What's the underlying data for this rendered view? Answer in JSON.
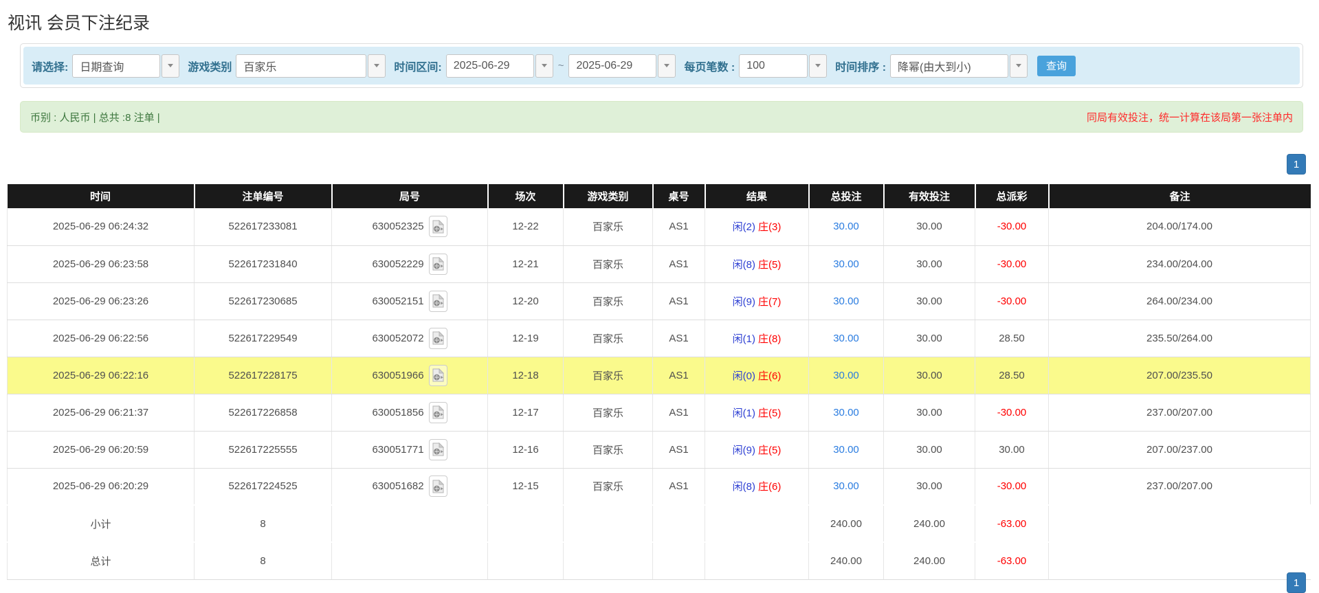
{
  "page_title": "视讯 会员下注纪录",
  "filter_bar": {
    "query_type": {
      "label": "请选择:",
      "value": "日期查询"
    },
    "game_category": {
      "label": "游戏类别",
      "value": "百家乐"
    },
    "time_range": {
      "label": "时间区间:",
      "from": "2025-06-29",
      "separator": "~",
      "to": "2025-06-29"
    },
    "page_size": {
      "label": "每页笔数 :",
      "value": "100"
    },
    "time_sort": {
      "label": "时间排序 :",
      "value": "降幂(由大到小)"
    },
    "search_button_label": "查询"
  },
  "summary_bar": {
    "currency_info": "币别 : 人民币 | 总共 :8 注单 |",
    "notice": "同局有效投注，统一计算在该局第一张注单内"
  },
  "pagination": {
    "current_page": "1"
  },
  "table": {
    "headers": [
      "时间",
      "注单编号",
      "局号",
      "场次",
      "游戏类别",
      "桌号",
      "结果",
      "总投注",
      "有效投注",
      "总派彩",
      "备注"
    ],
    "rows": [
      {
        "time": "2025-06-29 06:24:32",
        "bet_no": "522617233081",
        "round_no": "630052325",
        "session": "12-22",
        "game": "百家乐",
        "table_no": "AS1",
        "result_player": "闲(2)",
        "result_banker": "庄(3)",
        "total_bet": "30.00",
        "valid_bet": "30.00",
        "payout": "-30.00",
        "note": "204.00/174.00",
        "highlighted": false
      },
      {
        "time": "2025-06-29 06:23:58",
        "bet_no": "522617231840",
        "round_no": "630052229",
        "session": "12-21",
        "game": "百家乐",
        "table_no": "AS1",
        "result_player": "闲(8)",
        "result_banker": "庄(5)",
        "total_bet": "30.00",
        "valid_bet": "30.00",
        "payout": "-30.00",
        "note": "234.00/204.00",
        "highlighted": false
      },
      {
        "time": "2025-06-29 06:23:26",
        "bet_no": "522617230685",
        "round_no": "630052151",
        "session": "12-20",
        "game": "百家乐",
        "table_no": "AS1",
        "result_player": "闲(9)",
        "result_banker": "庄(7)",
        "total_bet": "30.00",
        "valid_bet": "30.00",
        "payout": "-30.00",
        "note": "264.00/234.00",
        "highlighted": false
      },
      {
        "time": "2025-06-29 06:22:56",
        "bet_no": "522617229549",
        "round_no": "630052072",
        "session": "12-19",
        "game": "百家乐",
        "table_no": "AS1",
        "result_player": "闲(1)",
        "result_banker": "庄(8)",
        "total_bet": "30.00",
        "valid_bet": "30.00",
        "payout": "28.50",
        "note": "235.50/264.00",
        "highlighted": false
      },
      {
        "time": "2025-06-29 06:22:16",
        "bet_no": "522617228175",
        "round_no": "630051966",
        "session": "12-18",
        "game": "百家乐",
        "table_no": "AS1",
        "result_player": "闲(0)",
        "result_banker": "庄(6)",
        "total_bet": "30.00",
        "valid_bet": "30.00",
        "payout": "28.50",
        "note": "207.00/235.50",
        "highlighted": true
      },
      {
        "time": "2025-06-29 06:21:37",
        "bet_no": "522617226858",
        "round_no": "630051856",
        "session": "12-17",
        "game": "百家乐",
        "table_no": "AS1",
        "result_player": "闲(1)",
        "result_banker": "庄(5)",
        "total_bet": "30.00",
        "valid_bet": "30.00",
        "payout": "-30.00",
        "note": "237.00/207.00",
        "highlighted": false
      },
      {
        "time": "2025-06-29 06:20:59",
        "bet_no": "522617225555",
        "round_no": "630051771",
        "session": "12-16",
        "game": "百家乐",
        "table_no": "AS1",
        "result_player": "闲(9)",
        "result_banker": "庄(5)",
        "total_bet": "30.00",
        "valid_bet": "30.00",
        "payout": "30.00",
        "note": "207.00/237.00",
        "highlighted": false
      },
      {
        "time": "2025-06-29 06:20:29",
        "bet_no": "522617224525",
        "round_no": "630051682",
        "session": "12-15",
        "game": "百家乐",
        "table_no": "AS1",
        "result_player": "闲(8)",
        "result_banker": "庄(6)",
        "total_bet": "30.00",
        "valid_bet": "30.00",
        "payout": "-30.00",
        "note": "237.00/207.00",
        "highlighted": false
      }
    ],
    "footer_rows": [
      {
        "label": "小计",
        "bet_count": "8",
        "total_bet": "240.00",
        "valid_bet": "240.00",
        "total_payout": "-63.00"
      },
      {
        "label": "总计",
        "bet_count": "8",
        "total_bet": "240.00",
        "valid_bet": "240.00",
        "total_payout": "-63.00"
      }
    ]
  },
  "colors": {
    "filter_bar_bg": "#d9edf7",
    "summary_bar_bg": "#dff0d8",
    "header_bg": "#1a1a1a",
    "footer_bg": "#999999",
    "highlight_yellow": "#fafa8c",
    "link_blue": "#2a7ce0",
    "player_blue": "#2d3fd3",
    "banker_red": "#ff0000",
    "negative_red": "#ff0000",
    "search_button_blue": "#49a2dc",
    "pagination_blue": "#337ab7"
  }
}
